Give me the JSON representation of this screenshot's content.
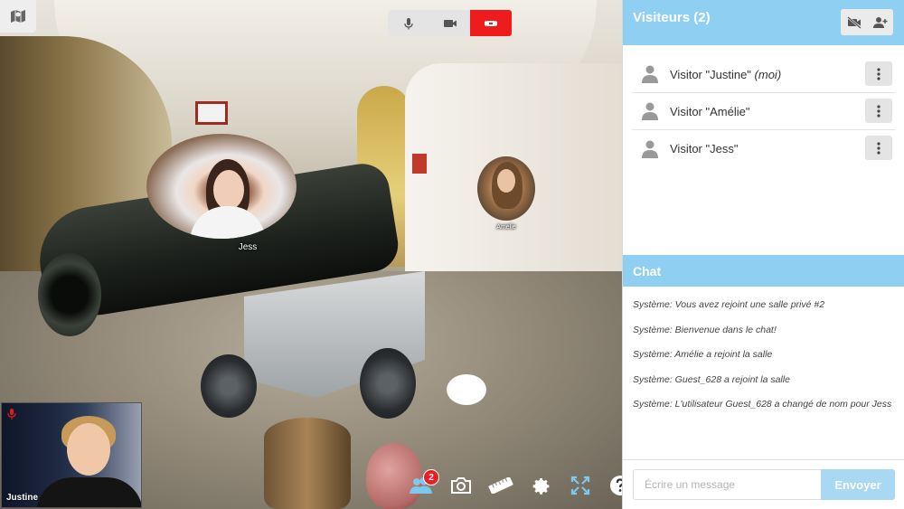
{
  "scene": {
    "avatars": [
      {
        "name": "Jess"
      },
      {
        "name": "Amélie"
      }
    ],
    "self_view": {
      "name": "Justine",
      "mic_state": "muted"
    }
  },
  "media_controls": [
    {
      "icon": "microphone-icon",
      "active": false
    },
    {
      "icon": "video-camera-icon",
      "active": false
    },
    {
      "icon": "hang-up-icon",
      "active": true,
      "color": "#ee1c1c"
    }
  ],
  "toolbar": {
    "visitors_badge": "2",
    "items": [
      "visitors-icon",
      "camera-snapshot-icon",
      "ruler-icon",
      "settings-gear-icon",
      "fullscreen-icon",
      "help-icon"
    ]
  },
  "visitors": {
    "title": "Visiteurs (2)",
    "list": [
      {
        "label": "Visitor \"Justine\"",
        "suffix": "(moi)"
      },
      {
        "label": "Visitor \"Amélie\"",
        "suffix": ""
      },
      {
        "label": "Visitor \"Jess\"",
        "suffix": ""
      }
    ]
  },
  "chat": {
    "title": "Chat",
    "messages": [
      "Système: Vous avez rejoint une salle privé #2",
      "Système: Bienvenue dans le chat!",
      "Système: Amélie a rejoint la salle",
      "Système: Guest_628 a rejoint la salle",
      "Système: L'utilisateur Guest_628 a changé de nom pour Jess"
    ],
    "input_placeholder": "Écrire un message",
    "send_label": "Envoyer"
  },
  "colors": {
    "panel_header": "#8ecff2",
    "send_button": "#a8d8f2",
    "danger": "#ee1c1c",
    "badge": "#ec1d24"
  }
}
